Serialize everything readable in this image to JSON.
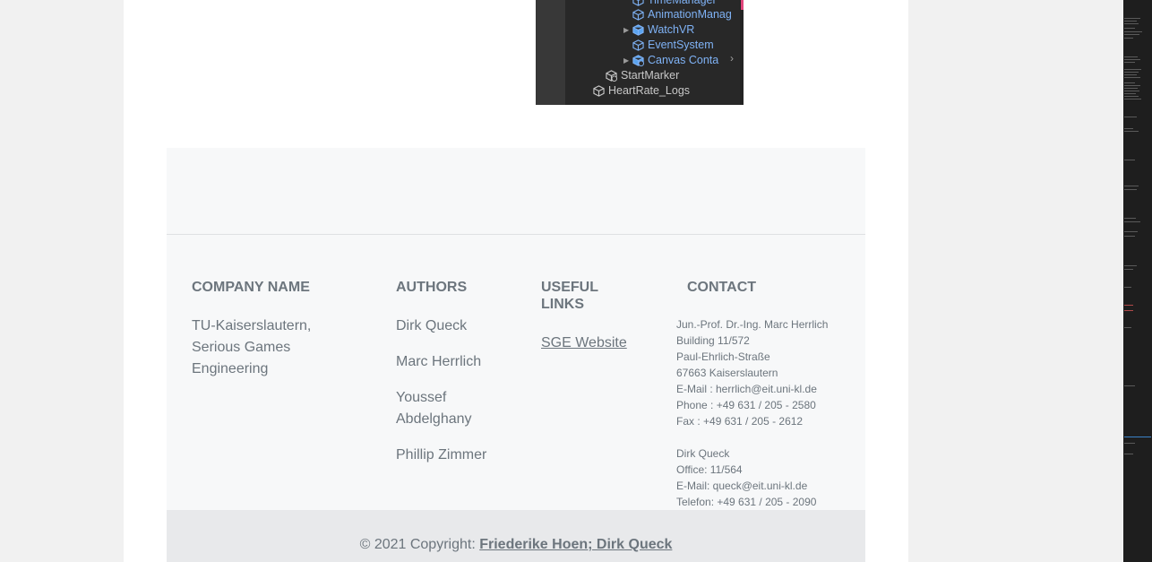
{
  "hierarchy": {
    "rows": [
      {
        "label": "TimeManager",
        "color": "blue",
        "icon": "cube-icon",
        "expandable": false
      },
      {
        "label": "AnimationManag",
        "color": "blue",
        "icon": "cube-icon",
        "expandable": false
      },
      {
        "label": "WatchVR",
        "color": "blue",
        "icon": "prefab-cube-icon",
        "expandable": true
      },
      {
        "label": "EventSystem",
        "color": "blue",
        "icon": "cube-icon",
        "expandable": false
      },
      {
        "label": "Canvas Conta",
        "color": "blue",
        "icon": "prefab-cube-add-icon",
        "expandable": true
      },
      {
        "label": "StartMarker",
        "color": "grey",
        "icon": "cube-add-icon",
        "expandable": false
      },
      {
        "label": "HeartRate_Logs",
        "color": "grey",
        "icon": "cube-icon",
        "expandable": false
      }
    ]
  },
  "footer": {
    "company": {
      "title": "Company name",
      "text_lines": [
        "TU-Kaiserslautern,",
        "Serious Games",
        "Engineering"
      ]
    },
    "authors": {
      "title": "Authors",
      "names": [
        {
          "lines": [
            "Dirk Queck"
          ]
        },
        {
          "lines": [
            "Marc Herrlich"
          ]
        },
        {
          "lines": [
            "Youssef",
            "Abdelghany"
          ]
        },
        {
          "lines": [
            "Phillip Zimmer"
          ]
        }
      ]
    },
    "links": {
      "title_lines": [
        "Useful",
        "links"
      ],
      "items": [
        "SGE Website"
      ]
    },
    "contact": {
      "title": "Contact",
      "lines": [
        "Jun.-Prof. Dr.-Ing. Marc Herrlich",
        "Building 11/572",
        "Paul-Ehrlich-Straße",
        "67663 Kaiserslautern",
        "E-Mail : herrlich@eit.uni-kl.de",
        "Phone : +49 631 / 205 - 2580",
        "Fax : +49 631 / 205 - 2612",
        "",
        "Dirk Queck",
        "Office: 11/564",
        "E-Mail: queck@eit.uni-kl.de",
        "Telefon: +49 631 / 205 - 2090"
      ]
    },
    "copyright": {
      "prefix": "© 2021 Copyright: ",
      "holders": "Friederike Hoen; Dirk Queck"
    }
  },
  "colors": {
    "footer_bg": "#f7f8f9",
    "copyright_bg": "#e8e9eb",
    "text_muted": "#6c757d",
    "hierarchy_blue": "#7fb2f5"
  }
}
